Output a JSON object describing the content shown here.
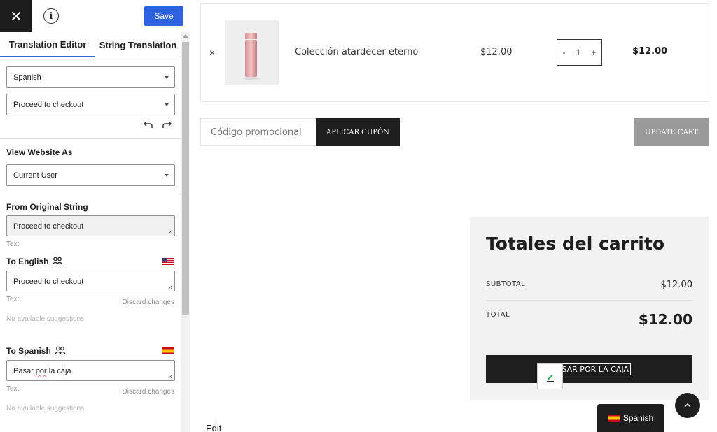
{
  "topbar": {
    "save_label": "Save"
  },
  "tabs": [
    {
      "label": "Translation Editor",
      "active": true
    },
    {
      "label": "String Translation",
      "active": false
    }
  ],
  "editor": {
    "language_select": "Spanish",
    "string_select": "Proceed to checkout",
    "view_as_title": "View Website As",
    "view_as_select": "Current User",
    "original_title": "From Original String",
    "original_value": "Proceed to checkout",
    "original_type": "Text",
    "english": {
      "title": "To English",
      "value": "Proceed to checkout",
      "type": "Text",
      "discard": "Discard changes",
      "suggestions": "No available suggestions"
    },
    "spanish": {
      "title": "To Spanish",
      "value_parts": [
        "Pasar ",
        "por",
        " la caja"
      ],
      "type": "Text",
      "discard": "Discard changes",
      "suggestions": "No available suggestions"
    }
  },
  "cart": {
    "item": {
      "name": "Colección atardecer eterno",
      "price": "$12.00",
      "qty": "1",
      "minus": "-",
      "plus": "+",
      "subtotal": "$12.00",
      "remove": "×"
    },
    "coupon_placeholder": "Código promocional",
    "apply_coupon": "APLICAR CUPÓN",
    "update_cart": "UPDATE CART"
  },
  "totals": {
    "title": "Totales del carrito",
    "subtotal_label": "SUBTOTAL",
    "subtotal_value": "$12.00",
    "total_label": "TOTAL",
    "total_value": "$12.00",
    "checkout_label": "PASAR POR LA CAJA"
  },
  "footer": {
    "edit": "Edit",
    "language": "Spanish"
  },
  "colors": {
    "accent": "#2f62e0",
    "dark": "#1e1e1e",
    "panel": "#f2f2f2"
  }
}
